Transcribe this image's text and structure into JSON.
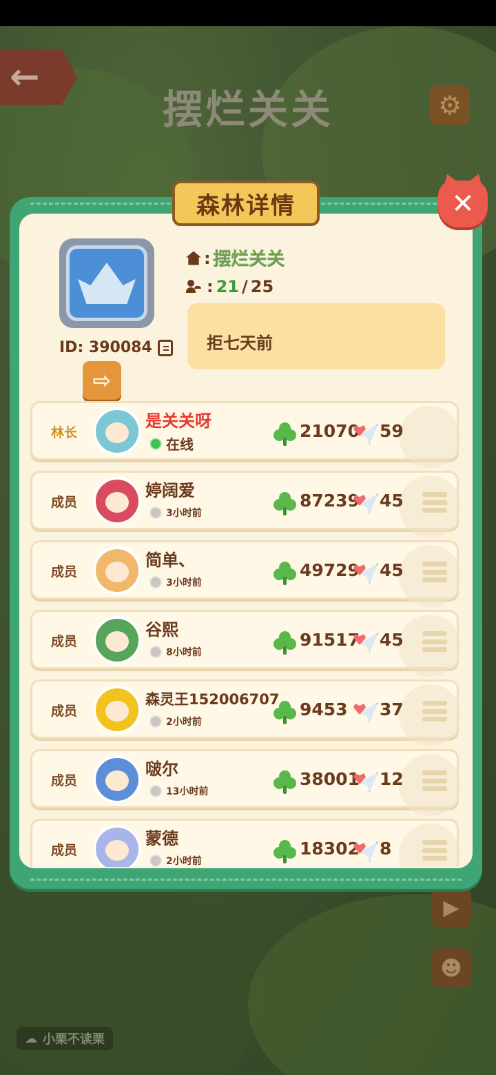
{
  "background": {
    "title": "摆烂关关",
    "chat_preview": "小栗不读栗"
  },
  "dialog": {
    "title": "森林详情",
    "forest_id_label": "ID: 390084",
    "forest_name": "摆烂关关",
    "member_count_current": "21",
    "member_count_separator": "/",
    "member_count_max": "25",
    "notice_text": "拒七天前",
    "colon": ":"
  },
  "members": [
    {
      "role": "林长",
      "name": "是关关呀",
      "status": "在线",
      "online": true,
      "score": "21070",
      "likes": "59",
      "avatar_color": "#7cc6d6",
      "is_leader": true
    },
    {
      "role": "成员",
      "name": "婷阔爱",
      "status": "3小时前",
      "online": false,
      "score": "87239",
      "likes": "45",
      "avatar_color": "#d94b5e"
    },
    {
      "role": "成员",
      "name": "简单、",
      "status": "3小时前",
      "online": false,
      "score": "49729",
      "likes": "45",
      "avatar_color": "#f2b86a"
    },
    {
      "role": "成员",
      "name": "谷熙",
      "status": "8小时前",
      "online": false,
      "score": "91517",
      "likes": "45",
      "avatar_color": "#56a55a"
    },
    {
      "role": "成员",
      "name": "森灵王152006707",
      "status": "2小时前",
      "online": false,
      "score": "9453",
      "likes": "37",
      "avatar_color": "#f2c21e"
    },
    {
      "role": "成员",
      "name": "啵尔",
      "status": "13小时前",
      "online": false,
      "score": "38001",
      "likes": "12",
      "avatar_color": "#5c8fd8"
    },
    {
      "role": "成员",
      "name": "蒙德",
      "status": "2小时前",
      "online": false,
      "score": "18302",
      "likes": "8",
      "avatar_color": "#a9b5e8"
    }
  ],
  "colors": {
    "panel_green": "#3fa574",
    "panel_cream": "#fcf3df",
    "title_gold": "#f4c75a",
    "close_red": "#ea5a4d",
    "leader_name_red": "#e8382e",
    "online_green": "#3fc14f"
  },
  "icons": [
    "back-arrow-icon",
    "gear-icon",
    "close-icon",
    "crown-icon",
    "copy-icon",
    "exit-icon",
    "home-icon",
    "people-icon",
    "clover-icon",
    "heart-plane-icon",
    "menu-icon"
  ]
}
